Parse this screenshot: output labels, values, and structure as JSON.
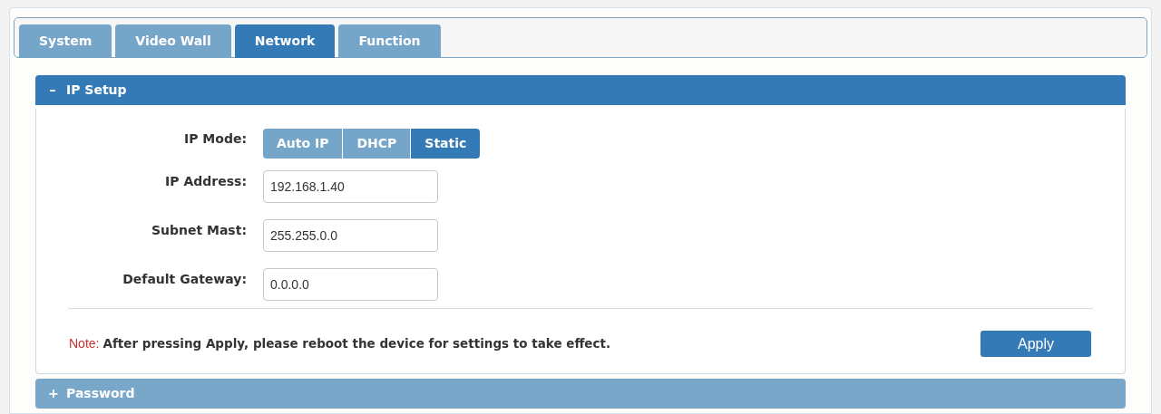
{
  "tabs": [
    {
      "label": "System",
      "selected": false
    },
    {
      "label": "Video Wall",
      "selected": false
    },
    {
      "label": "Network",
      "selected": true
    },
    {
      "label": "Function",
      "selected": false
    }
  ],
  "sections": [
    {
      "icon": "–",
      "title": "IP Setup",
      "expanded": true,
      "ip_mode": {
        "label": "IP Mode:",
        "options": [
          {
            "label": "Auto IP",
            "selected": false
          },
          {
            "label": "DHCP",
            "selected": false
          },
          {
            "label": "Static",
            "selected": true
          }
        ]
      },
      "fields": [
        {
          "label": "IP Address:",
          "value": "192.168.1.40"
        },
        {
          "label": "Subnet Mast:",
          "value": "255.255.0.0"
        },
        {
          "label": "Default Gateway:",
          "value": "0.0.0.0"
        }
      ],
      "note": {
        "label": "Note:",
        "text": "After pressing Apply, please reboot the device for settings to take effect."
      },
      "apply_button": "Apply"
    },
    {
      "icon": "+",
      "title": "Password",
      "expanded": false
    }
  ]
}
